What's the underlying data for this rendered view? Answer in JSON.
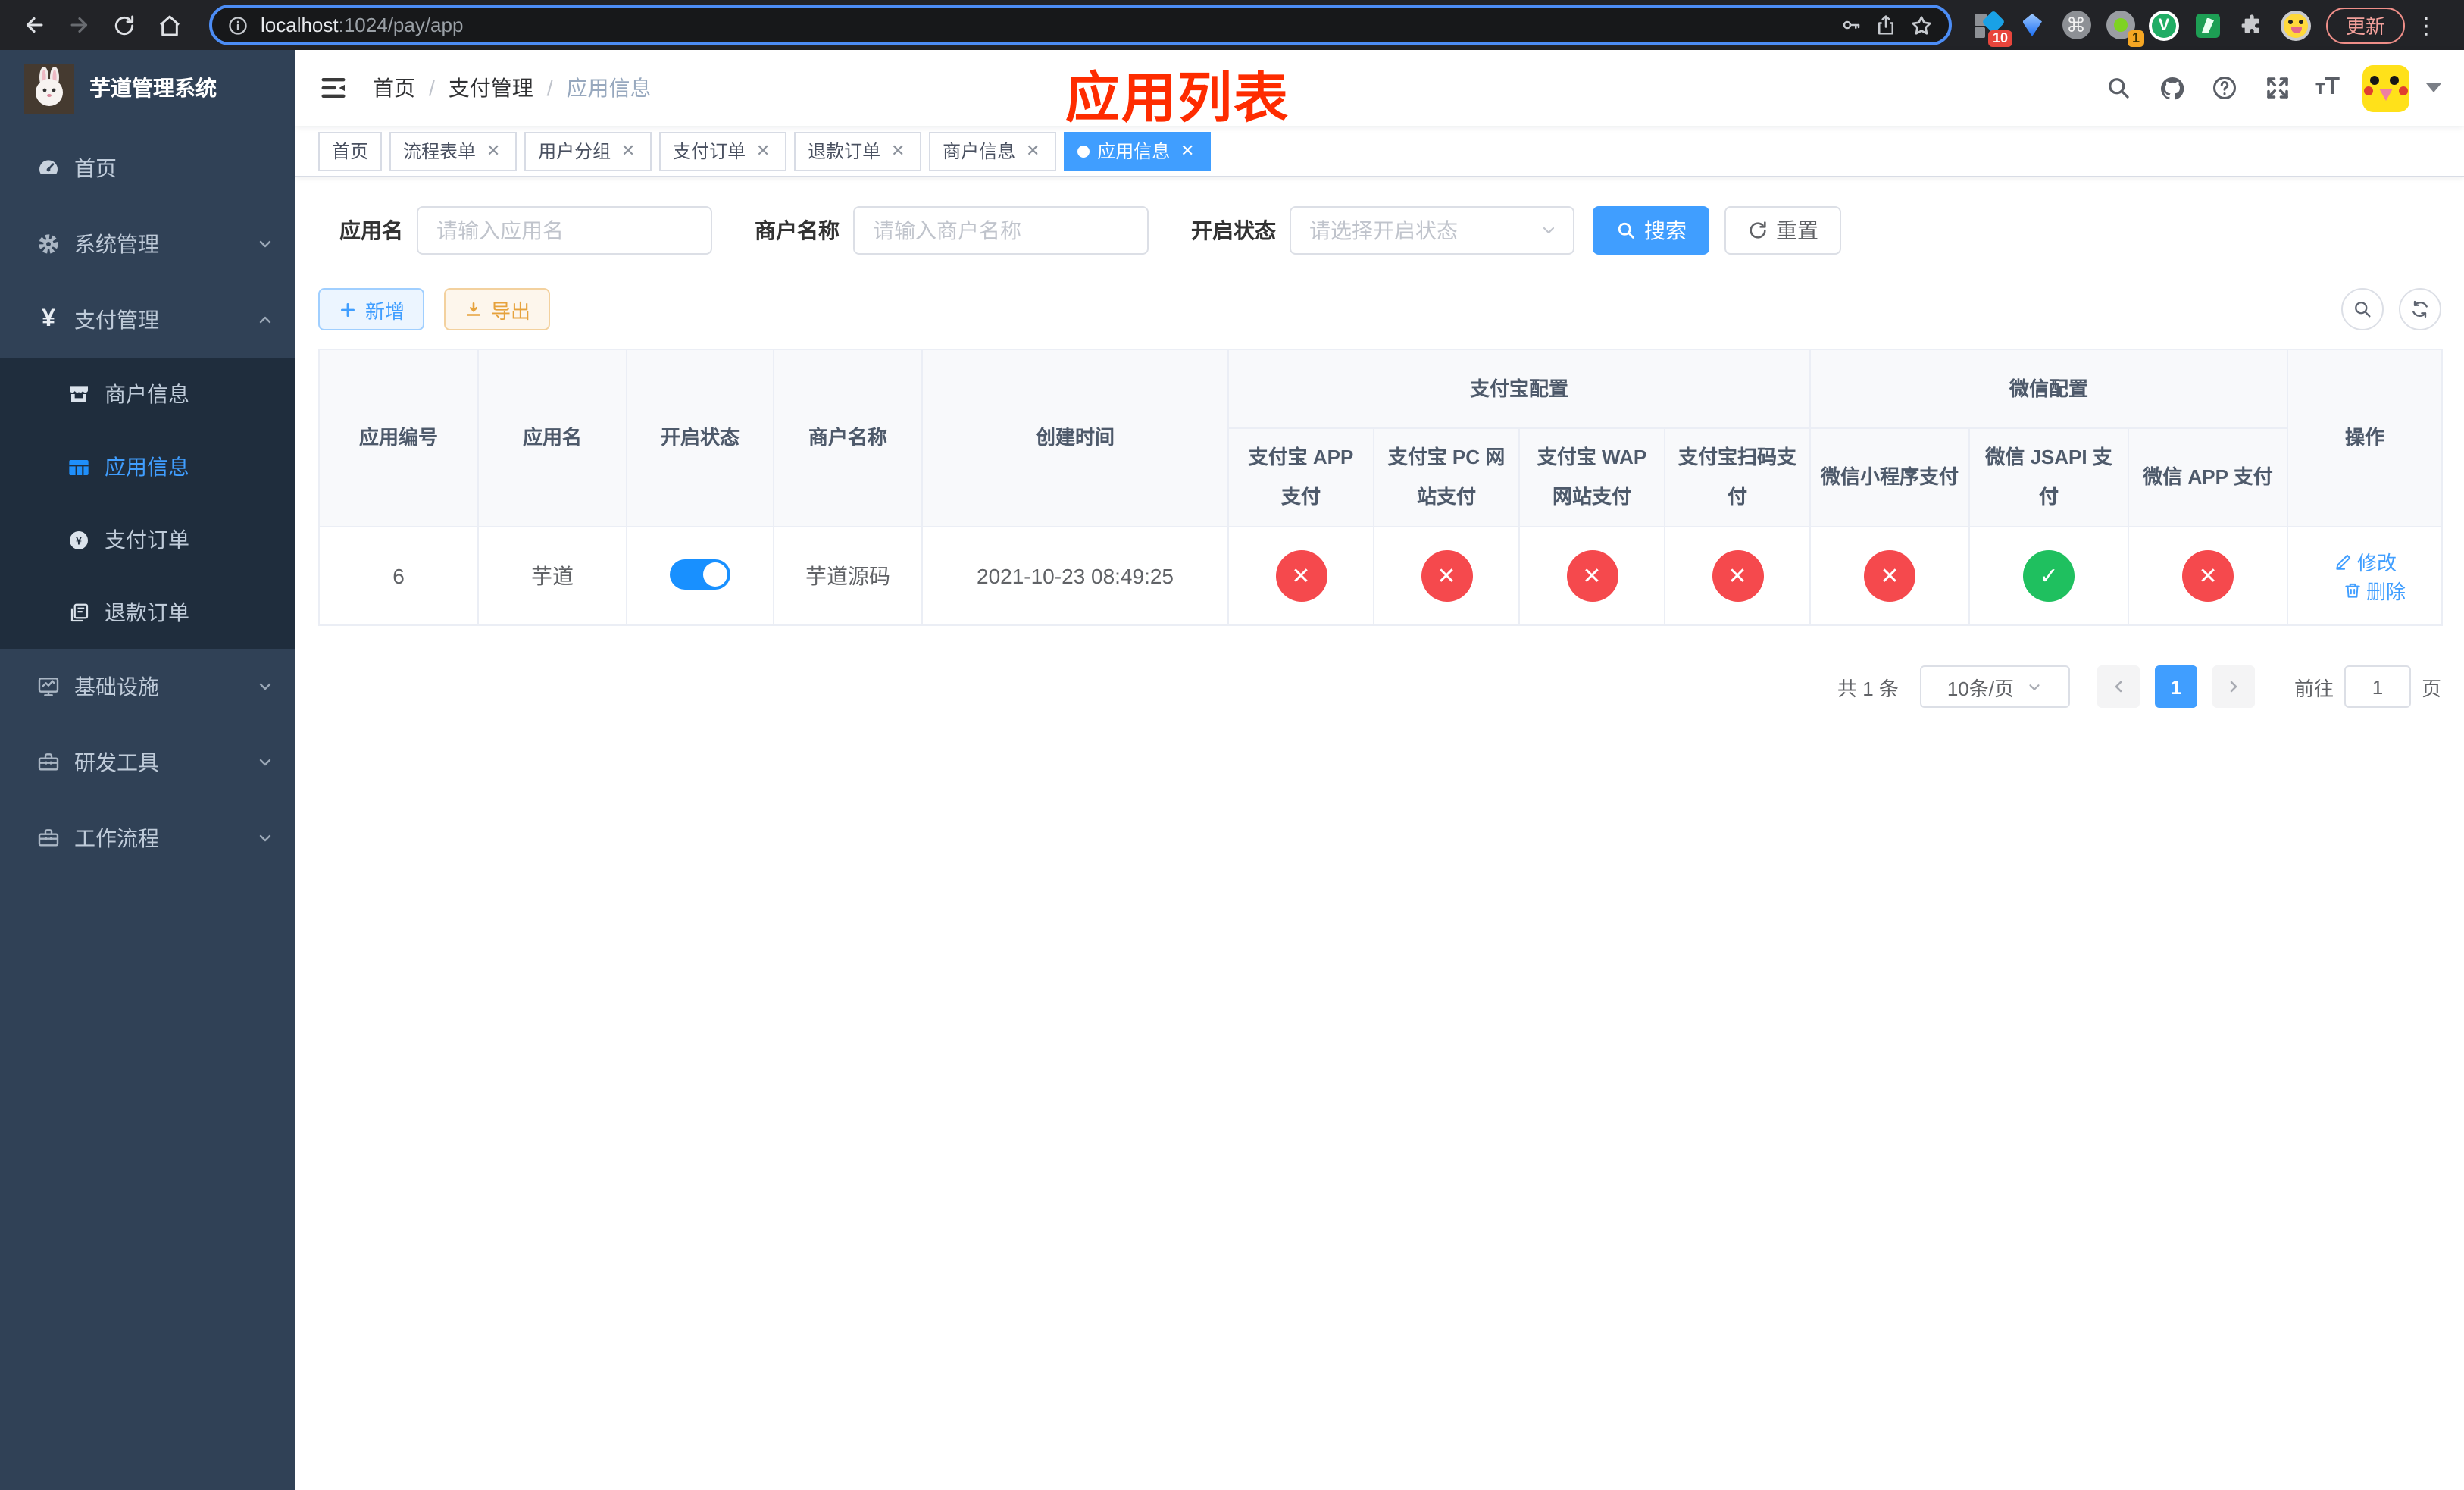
{
  "browser": {
    "url_host": "localhost",
    "url_path": ":1024/pay/app",
    "update_label": "更新",
    "ext_badge_blocks": "10",
    "ext_badge_record": "1",
    "vue_letter": "V",
    "cmd_glyph": "⌘"
  },
  "annotation": {
    "title": "应用列表"
  },
  "sidebar": {
    "app_title": "芋道管理系统",
    "menu": [
      {
        "label": "首页"
      },
      {
        "label": "系统管理"
      },
      {
        "label": "支付管理"
      },
      {
        "label": "基础设施"
      },
      {
        "label": "研发工具"
      },
      {
        "label": "工作流程"
      }
    ],
    "submenu": [
      {
        "label": "商户信息"
      },
      {
        "label": "应用信息"
      },
      {
        "label": "支付订单"
      },
      {
        "label": "退款订单"
      }
    ]
  },
  "breadcrumb": {
    "home": "首页",
    "section": "支付管理",
    "current": "应用信息",
    "separator": "/"
  },
  "tabs": [
    {
      "label": "首页"
    },
    {
      "label": "流程表单"
    },
    {
      "label": "用户分组"
    },
    {
      "label": "支付订单"
    },
    {
      "label": "退款订单"
    },
    {
      "label": "商户信息"
    },
    {
      "label": "应用信息"
    }
  ],
  "filters": {
    "app_name_label": "应用名",
    "app_name_placeholder": "请输入应用名",
    "merchant_label": "商户名称",
    "merchant_placeholder": "请输入商户名称",
    "status_label": "开启状态",
    "status_placeholder": "请选择开启状态",
    "search_label": "搜索",
    "reset_label": "重置"
  },
  "toolbar": {
    "add_label": "新增",
    "export_label": "导出"
  },
  "table": {
    "headers": {
      "app_id": "应用编号",
      "app_name": "应用名",
      "status": "开启状态",
      "merchant": "商户名称",
      "created": "创建时间",
      "alipay_group": "支付宝配置",
      "wechat_group": "微信配置",
      "alipay_app": "支付宝 APP 支付",
      "alipay_pc": "支付宝 PC 网站支付",
      "alipay_wap": "支付宝 WAP 网站支付",
      "alipay_qr": "支付宝扫码支付",
      "wechat_lite": "微信小程序支付",
      "wechat_jsapi": "微信 JSAPI 支付",
      "wechat_app": "微信 APP 支付",
      "actions": "操作"
    },
    "rows": [
      {
        "app_id": "6",
        "app_name": "芋道",
        "status_on": true,
        "merchant": "芋道源码",
        "created": "2021-10-23 08:49:25",
        "alipay_app": false,
        "alipay_pc": false,
        "alipay_wap": false,
        "alipay_qr": false,
        "wechat_lite": false,
        "wechat_jsapi": true,
        "wechat_app": false,
        "edit_label": "修改",
        "delete_label": "删除"
      }
    ]
  },
  "pagination": {
    "total": "共 1 条",
    "page_size": "10条/页",
    "current_page": "1",
    "goto_prefix": "前往",
    "goto_value": "1",
    "goto_suffix": "页"
  },
  "colors": {
    "primary": "#409eff",
    "success": "#1fc05f",
    "danger": "#f5494d",
    "warning": "#e6a23c",
    "annotation_red": "#fe2c00",
    "sidebar_bg": "#304156",
    "submenu_bg": "#1f2d3d"
  }
}
